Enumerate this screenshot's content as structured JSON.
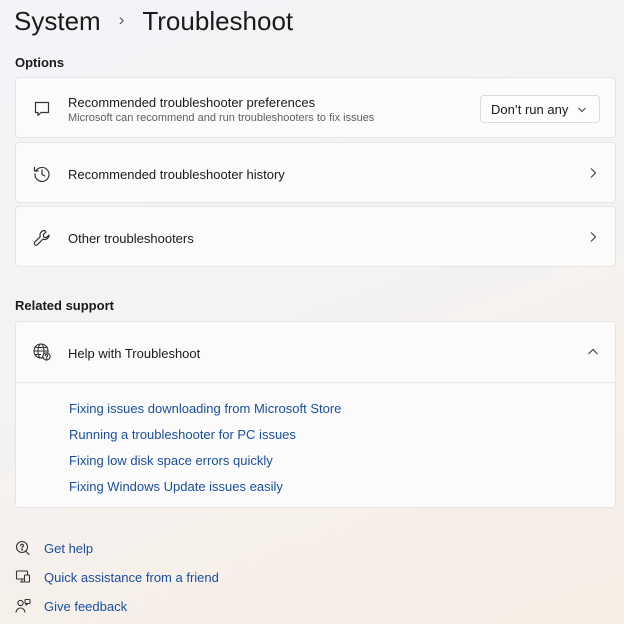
{
  "breadcrumb": {
    "parent": "System",
    "current": "Troubleshoot"
  },
  "options": {
    "label": "Options",
    "preferences": {
      "title": "Recommended troubleshooter preferences",
      "subtitle": "Microsoft can recommend and run troubleshooters to fix issues",
      "dropdown_value": "Don’t run any"
    },
    "history": {
      "title": "Recommended troubleshooter history"
    },
    "other": {
      "title": "Other troubleshooters"
    }
  },
  "related": {
    "label": "Related support",
    "help": {
      "title": "Help with Troubleshoot",
      "links": [
        "Fixing issues downloading from Microsoft Store",
        "Running a troubleshooter for PC issues",
        "Fixing low disk space errors quickly",
        "Fixing Windows Update issues easily"
      ]
    }
  },
  "footer": {
    "get_help": "Get help",
    "quick_assist": "Quick assistance from a friend",
    "feedback": "Give feedback"
  },
  "colors": {
    "link": "#1a4fa0",
    "card": "#fbfbfb"
  }
}
